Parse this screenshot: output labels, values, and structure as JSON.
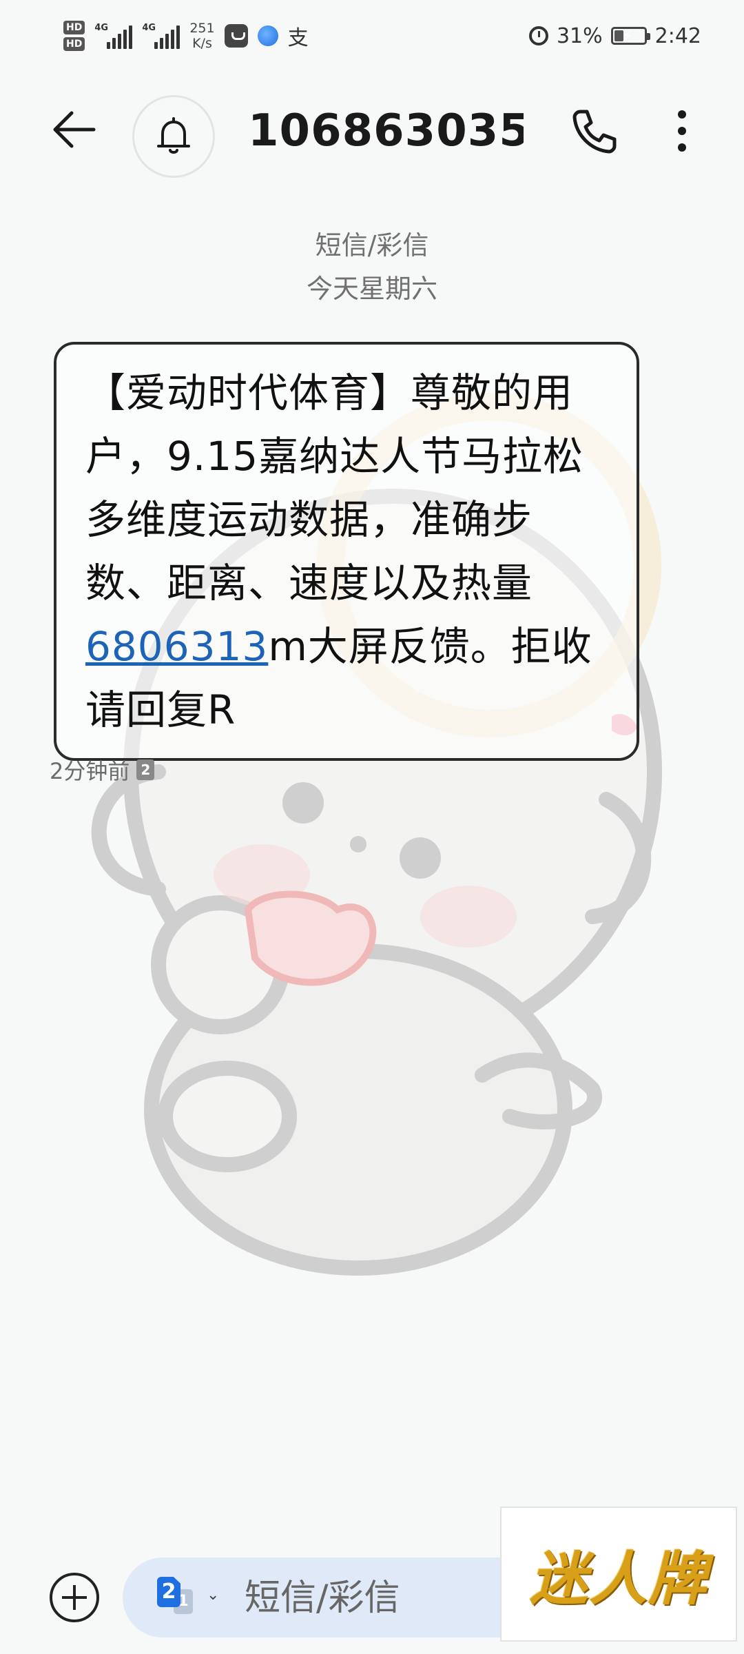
{
  "status_bar": {
    "hd1": "HD",
    "hd2": "HD",
    "net1": "4G",
    "net2": "4G",
    "net_speed_value": "251",
    "net_speed_unit": "K/s",
    "app_icons": [
      "shopping-bag-icon",
      "globe-icon",
      "alipay-icon"
    ],
    "alipay_glyph": "支",
    "battery_percent": "31%",
    "battery_level": 0.31,
    "time": "2:42"
  },
  "header": {
    "sender": "106863035..."
  },
  "conversation": {
    "channel": "短信/彩信",
    "date": "今天星期六"
  },
  "message": {
    "text_before": "【爱动时代体育】尊敬的用户，9.15嘉纳达人节马拉松多维度运动数据，准确步数、距离、速度以及热量",
    "link": "6806313",
    "text_after": "m大屏反馈。拒收请回复R",
    "time": "2分钟前",
    "sim": "2"
  },
  "compose": {
    "placeholder": "短信/彩信",
    "sim_primary": "2",
    "sim_secondary": "1"
  },
  "watermark": {
    "text": "迷人牌"
  },
  "colors": {
    "background": "#f7f8f8",
    "link": "#1d63b7",
    "compose_bar": "#dfe9f7",
    "sim_accent": "#1f6fe0",
    "watermark": "#d8a019"
  }
}
